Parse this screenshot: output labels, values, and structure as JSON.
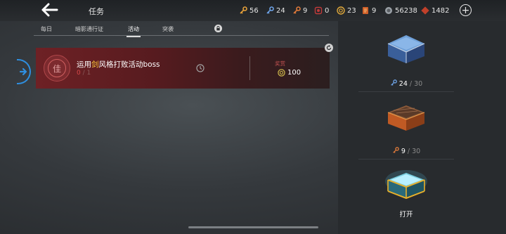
{
  "header": {
    "title": "任务",
    "resources": [
      {
        "icon": "gold-key-icon",
        "value": "56"
      },
      {
        "icon": "blue-key-icon",
        "value": "24"
      },
      {
        "icon": "bronze-key-icon",
        "value": "9"
      },
      {
        "icon": "red-token-icon",
        "value": "0"
      },
      {
        "icon": "gold-coin-icon",
        "value": "23"
      },
      {
        "icon": "scroll-icon",
        "value": "9"
      },
      {
        "icon": "silver-coin-icon",
        "value": "56238"
      },
      {
        "icon": "diamond-icon",
        "value": "1482"
      }
    ]
  },
  "tabs": [
    "每日",
    "暗影通行证",
    "活动",
    "突袭"
  ],
  "active_tab": "活动",
  "task": {
    "badge_glyph": "佳",
    "name_prefix": "运用",
    "name_highlight": "剑",
    "name_suffix": "风格打败活动boss",
    "progress_current": "0",
    "progress_sep": " / ",
    "progress_total": "1",
    "reward_label": "奖赏",
    "reward_value": "100"
  },
  "chests": [
    {
      "key_current": "24",
      "key_sep": " / ",
      "key_total": "30",
      "key_icon": "blue-key-icon"
    },
    {
      "key_current": "9",
      "key_sep": " / ",
      "key_total": "30",
      "key_icon": "bronze-key-icon"
    },
    {
      "action_label": "打开",
      "key_icon": "gold-key-icon"
    }
  ],
  "colors": {
    "accent_blue": "#2f8fe0",
    "task_red": "#6e2125",
    "highlight_gold": "#ffcf3a"
  }
}
